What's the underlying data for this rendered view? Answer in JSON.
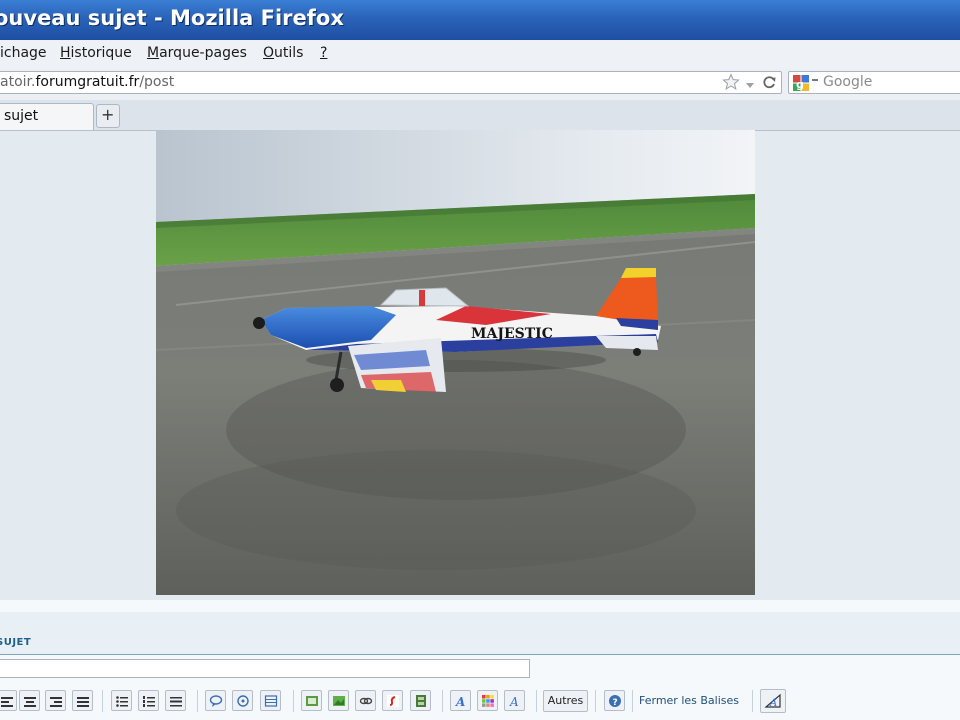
{
  "window": {
    "title": "ouveau sujet - Mozilla Firefox"
  },
  "menu": {
    "items": [
      {
        "pre": "",
        "ul": "",
        "post": "ichage"
      },
      {
        "pre": "",
        "ul": "H",
        "post": "istorique"
      },
      {
        "pre": "",
        "ul": "M",
        "post": "arque-pages"
      },
      {
        "pre": "",
        "ul": "O",
        "post": "utils"
      },
      {
        "pre": "",
        "ul": "?",
        "post": ""
      }
    ]
  },
  "nav": {
    "url_prefix": "atoir.",
    "url_domain": "forumgratuit.fr",
    "url_suffix": "/post",
    "search_placeholder": "Google",
    "icons": [
      "star-icon",
      "dropdown-arrow-icon",
      "reload-icon",
      "google-icon"
    ]
  },
  "tabs": {
    "active_label": "sujet",
    "new_tab_label": "+"
  },
  "photo": {
    "plane_text": "MAJESTIC"
  },
  "form": {
    "section_title": "SUJET",
    "subject_value": "",
    "autres_label": "Autres",
    "close_tags_label": "Fermer les Balises"
  },
  "colors": {
    "titlebar": "#2a63b8",
    "content_bg": "#e3ebf1",
    "link": "#1f4f7a"
  }
}
